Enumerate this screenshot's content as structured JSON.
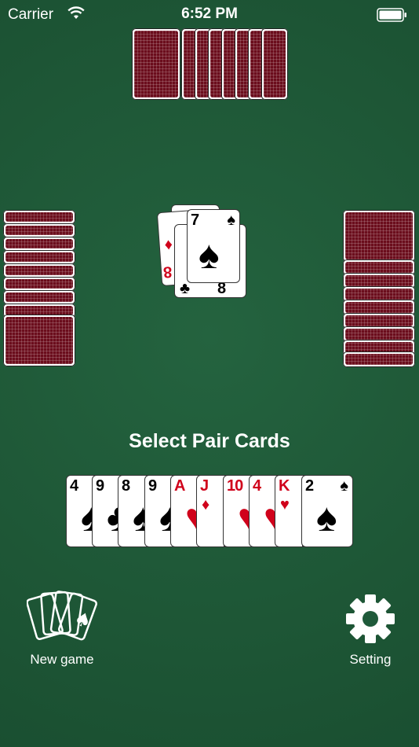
{
  "status_bar": {
    "carrier": "Carrier",
    "time": "6:52 PM"
  },
  "table": {
    "prompt": "Select Pair Cards",
    "center_cards": [
      {
        "rank": "7",
        "suit": "♠",
        "color": "black"
      },
      {
        "rank": "8",
        "suit": "♣",
        "color": "black"
      },
      {
        "rank": "8",
        "suit": "♦",
        "color": "red"
      }
    ],
    "hand": [
      {
        "rank": "4",
        "suit": "♠",
        "color": "black"
      },
      {
        "rank": "9",
        "suit": "♣",
        "color": "black"
      },
      {
        "rank": "8",
        "suit": "♠",
        "color": "black"
      },
      {
        "rank": "9",
        "suit": "♠",
        "color": "black"
      },
      {
        "rank": "A",
        "suit": "♥",
        "color": "red"
      },
      {
        "rank": "J",
        "suit": "♦",
        "color": "red"
      },
      {
        "rank": "10",
        "suit": "♥",
        "color": "red"
      },
      {
        "rank": "4",
        "suit": "♥",
        "color": "red"
      },
      {
        "rank": "K",
        "suit": "♥",
        "color": "red"
      },
      {
        "rank": "2",
        "suit": "♠",
        "color": "black"
      }
    ]
  },
  "buttons": {
    "new_game": "New game",
    "setting": "Setting"
  },
  "colors": {
    "felt": "#1f5a3a",
    "card_back": "#6b0d1c",
    "red_suit": "#d0021b"
  }
}
